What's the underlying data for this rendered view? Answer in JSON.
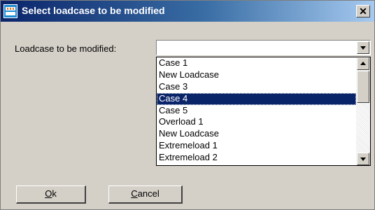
{
  "window": {
    "title": "Select loadcase to be modified",
    "icon_name": "app-logo-icon",
    "close_label": "✕"
  },
  "form": {
    "label": "Loadcase to be modified:",
    "combo_value": ""
  },
  "list": {
    "items": [
      "Case 1",
      "New Loadcase",
      "Case 3",
      "Case 4",
      "Case 5",
      "Overload 1",
      "New Loadcase",
      "Extremeload 1",
      "Extremeload 2"
    ],
    "selected_index": 3
  },
  "buttons": {
    "ok": {
      "mnemonic": "O",
      "rest": "k"
    },
    "cancel": {
      "mnemonic": "C",
      "rest": "ancel"
    }
  },
  "colors": {
    "title_bar_start": "#0a246a",
    "title_bar_end": "#a6caf0",
    "selection": "#0a246a",
    "dialog_face": "#d4d0c8"
  }
}
